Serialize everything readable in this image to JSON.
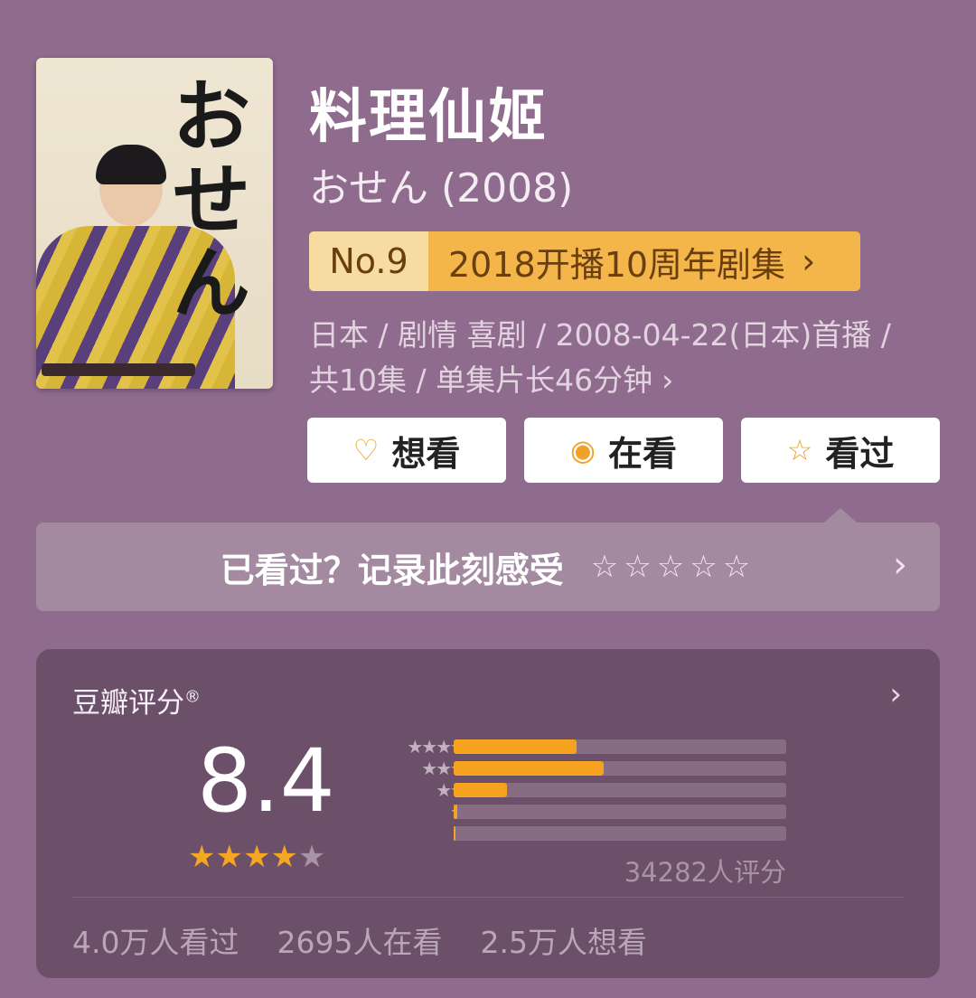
{
  "poster": {
    "calligraphy": "おせん"
  },
  "title": "料理仙姬",
  "subtitle": "おせん (2008)",
  "rank": {
    "no": "No.9",
    "label": "2018开播10周年剧集",
    "arrow": "›"
  },
  "meta": {
    "line1": "日本 / 剧情 喜剧 / 2008-04-22(日本)首播 /",
    "line2": "共10集 / 单集片长46分钟",
    "chev": "›"
  },
  "actions": {
    "want": {
      "icon": "heart-plus-icon",
      "glyph": "♡",
      "label": "想看"
    },
    "watching": {
      "icon": "target-icon",
      "glyph": "◉",
      "label": "在看"
    },
    "watched": {
      "icon": "star-icon",
      "glyph": "☆",
      "label": "看过"
    }
  },
  "record": {
    "text": "已看过？记录此刻感受",
    "stars": "☆☆☆☆☆",
    "chev": "›"
  },
  "rating": {
    "title": "豆瓣评分",
    "reg": "®",
    "chev": "›",
    "score": "8.4",
    "stars_on": "★★★★",
    "stars_off": "★",
    "votes": "34282人评分",
    "distribution": [
      {
        "stars": "★★★★★",
        "fraction": 0.37
      },
      {
        "stars": "★★★★",
        "fraction": 0.45
      },
      {
        "stars": "★★★",
        "fraction": 0.16
      },
      {
        "stars": "★★",
        "fraction": 0.01
      },
      {
        "stars": "★",
        "fraction": 0.005
      }
    ],
    "stats": {
      "watched": "4.0万人看过",
      "watching": "2695人在看",
      "want": "2.5万人想看"
    }
  },
  "colors": {
    "background": "#8f6b8d",
    "accent": "#f5a21f",
    "card": "#6c4f69"
  }
}
